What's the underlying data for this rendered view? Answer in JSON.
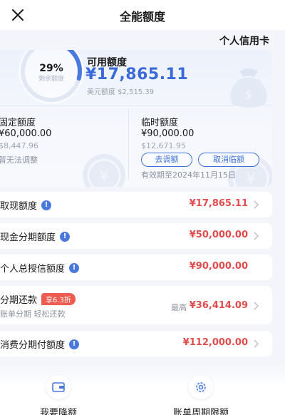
{
  "header": {
    "title": "全能额度"
  },
  "card_type": "个人信用卡",
  "overview": {
    "remaining_percent_text": "29%",
    "remaining_percent": 29,
    "remaining_label": "剩余额度",
    "available_label": "可用额度",
    "available_amount": "¥17,865.11",
    "available_usd": "美元额度 $2,515.39"
  },
  "fixed": {
    "label": "固定额度",
    "amount": "¥60,000.00",
    "usd": "$8,447.96",
    "note": "暂无法调整"
  },
  "temporary": {
    "label": "临时额度",
    "amount": "¥90,000.00",
    "usd": "$12,671.95",
    "adjust_button": "去调额",
    "cancel_button": "取消临额",
    "expiry": "有效期至2024年11月15日"
  },
  "rows": {
    "cash": {
      "label": "取现额度",
      "value": "¥17,865.11"
    },
    "installment": {
      "label": "现金分期额度",
      "value": "¥50,000.00"
    },
    "total": {
      "label": "个人总授信额度",
      "value": "¥90,000.00"
    },
    "bill_installment": {
      "label": "分期还款",
      "badge": "享6.3折",
      "sub": "账单分期 轻松还款",
      "max_label": "最高",
      "value": "¥36,414.09"
    },
    "consumer": {
      "label": "消费分期付额度",
      "value": "¥112,000.00"
    }
  },
  "bottom": {
    "reduce_label": "我要降额",
    "cycle_label": "账单周期限额"
  },
  "colors": {
    "accent": "#3f72d9",
    "amount_red": "#e24b4b",
    "ring_blue": "#4a79dd"
  }
}
